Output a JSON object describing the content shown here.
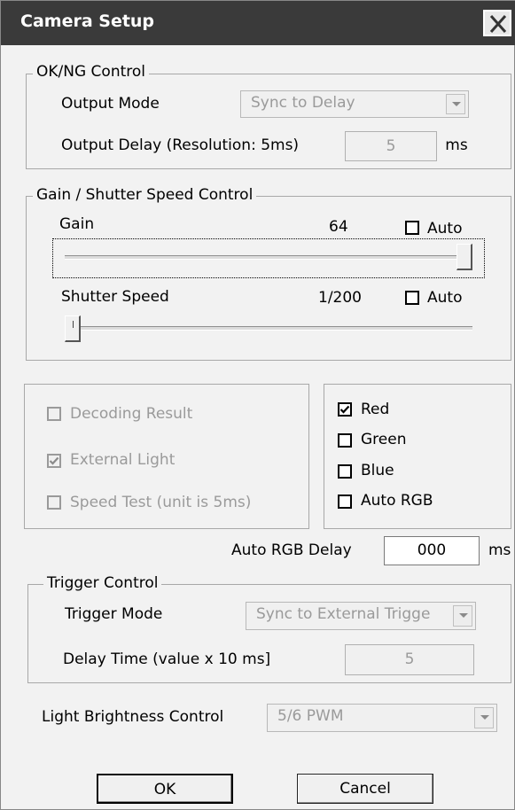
{
  "window": {
    "title": "Camera Setup"
  },
  "okng": {
    "legend": "OK/NG Control",
    "output_mode_label": "Output Mode",
    "output_mode_value": "Sync to Delay",
    "output_delay_label": "Output Delay (Resolution: 5ms)",
    "output_delay_value": "5",
    "output_delay_unit": "ms"
  },
  "gain_shutter": {
    "legend": "Gain / Shutter Speed  Control",
    "gain_label": "Gain",
    "gain_value": "64",
    "gain_auto_label": "Auto",
    "gain_auto_checked": false,
    "gain_level": 1.0,
    "shutter_label": "Shutter Speed",
    "shutter_value": "1/200",
    "shutter_auto_label": "Auto",
    "shutter_auto_checked": false,
    "shutter_level": 0.0
  },
  "options": {
    "decoding_result": {
      "label": "Decoding Result",
      "checked": false,
      "enabled": false
    },
    "external_light": {
      "label": "External Light",
      "checked": true,
      "enabled": false
    },
    "speed_test": {
      "label": "Speed Test (unit is 5ms)",
      "checked": false,
      "enabled": false
    }
  },
  "rgb": {
    "red": {
      "label": "Red",
      "checked": true
    },
    "green": {
      "label": "Green",
      "checked": false
    },
    "blue": {
      "label": "Blue",
      "checked": false
    },
    "auto_rgb": {
      "label": "Auto RGB",
      "checked": false
    },
    "auto_rgb_delay_label": "Auto RGB Delay",
    "auto_rgb_delay_value": "000",
    "auto_rgb_delay_unit": "ms"
  },
  "trigger": {
    "legend": "Trigger Control",
    "mode_label": "Trigger Mode",
    "mode_value": "Sync to External Trigge",
    "delay_label": "Delay Time (value x 10 ms]",
    "delay_value": "5"
  },
  "light": {
    "label": "Light Brightness Control",
    "value": "5/6 PWM"
  },
  "buttons": {
    "ok": "OK",
    "cancel": "Cancel"
  }
}
